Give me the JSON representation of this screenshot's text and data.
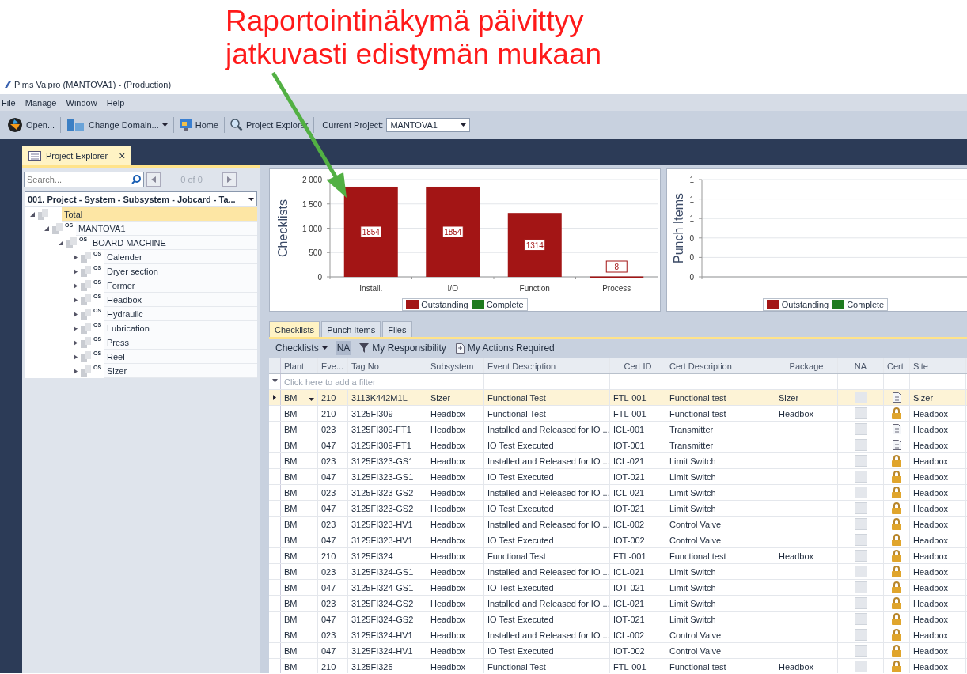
{
  "annotation": {
    "lines": [
      "Raportointinäkymä päivittyy",
      "jatkuvasti edistymän mukaan"
    ]
  },
  "window": {
    "title": "Pims Valpro (MANTOVA1) - (Production)"
  },
  "menu": [
    "File",
    "Manage",
    "Window",
    "Help"
  ],
  "toolbar": {
    "items": [
      {
        "label": "Open...",
        "kind": "open",
        "dropdown": false
      },
      {
        "label": "Change Domain...",
        "kind": "domain",
        "dropdown": true
      },
      {
        "label": "Home",
        "kind": "home",
        "dropdown": false
      },
      {
        "label": "Project Explorer",
        "kind": "explorer",
        "dropdown": false
      }
    ],
    "project_label": "Current Project:",
    "project_value": "MANTOVA1"
  },
  "doc_tabs": [
    {
      "label": "Project Explorer",
      "close": "×",
      "selected": true
    }
  ],
  "explorer": {
    "search": {
      "placeholder": "Search..."
    },
    "pager": "0 of 0",
    "view": "001. Project - System - Subsystem - Jobcard - Ta...",
    "tree": [
      {
        "label": "Total",
        "selected": true,
        "expanded": true,
        "children": [
          {
            "label": "MANTOVA1",
            "type_label": "OS",
            "selected": false,
            "expanded": true,
            "children": [
              {
                "label": "BOARD MACHINE",
                "type_label": "OS",
                "selected": false,
                "expanded": true,
                "children": [
                  {
                    "label": "Calender",
                    "type_label": "OS",
                    "selected": false,
                    "expanded": false
                  },
                  {
                    "label": "Dryer section",
                    "type_label": "OS",
                    "selected": false,
                    "expanded": false
                  },
                  {
                    "label": "Former",
                    "type_label": "OS",
                    "selected": false,
                    "expanded": false
                  },
                  {
                    "label": "Headbox",
                    "type_label": "OS",
                    "selected": false,
                    "expanded": false
                  },
                  {
                    "label": "Hydraulic",
                    "type_label": "OS",
                    "selected": false,
                    "expanded": false
                  },
                  {
                    "label": "Lubrication",
                    "type_label": "OS",
                    "selected": false,
                    "expanded": false
                  },
                  {
                    "label": "Press",
                    "type_label": "OS",
                    "selected": false,
                    "expanded": false
                  },
                  {
                    "label": "Reel",
                    "type_label": "OS",
                    "selected": false,
                    "expanded": false
                  },
                  {
                    "label": "Sizer",
                    "type_label": "OS",
                    "selected": false,
                    "expanded": false
                  }
                ]
              }
            ]
          }
        ]
      }
    ]
  },
  "charts": [
    {
      "chart_data": {
        "type": "bar",
        "ylabel": "Checklists",
        "categories": [
          "Install.",
          "I/O",
          "Function",
          "Process"
        ],
        "series": [
          {
            "name": "Outstanding",
            "color": "#a31515",
            "values": [
              1854,
              1854,
              1314,
              8
            ]
          },
          {
            "name": "Complete",
            "color": "#1e7b1e",
            "values": [
              null,
              null,
              null,
              null
            ]
          }
        ],
        "grid": true,
        "ylim": [
          0,
          2000
        ],
        "yticks": [
          0,
          {
            "value": 500,
            "label": "500"
          },
          {
            "value": 1000,
            "label": "1 000"
          },
          {
            "value": 1500,
            "label": "1 500"
          },
          {
            "value": 2000,
            "label": "2 000"
          }
        ],
        "data_labels": true
      }
    },
    {
      "chart_data": {
        "type": "bar",
        "ylabel": "Punch Items",
        "series": [
          {
            "name": "Outstanding",
            "color": "#a31515"
          },
          {
            "name": "Complete",
            "color": "#1e7b1e"
          }
        ],
        "grid": true,
        "ylim": [
          0,
          1
        ],
        "yticks": [
          {
            "value": 0,
            "label": "0"
          },
          {
            "value": 0.2,
            "label": "0"
          },
          {
            "value": 0.4,
            "label": "0"
          },
          {
            "value": 0.6,
            "label": "1"
          },
          {
            "value": 0.8,
            "label": "1"
          },
          {
            "value": 1,
            "label": "1"
          }
        ]
      }
    }
  ],
  "grid_tabs": [
    {
      "label": "Checklists",
      "selected": true
    },
    {
      "label": "Punch Items",
      "selected": false
    },
    {
      "label": "Files",
      "selected": false
    }
  ],
  "grid_toolbar": {
    "menu": "Checklists",
    "na": {
      "label": "NA",
      "pressed": true
    },
    "responsibility": "My Responsibility",
    "actions": "My Actions Required"
  },
  "table": {
    "columns": [
      "Plant",
      "Eve...",
      "Tag No",
      "Subsystem",
      "Event Description",
      "Cert ID",
      "Cert Description",
      "Package",
      "NA",
      "Cert",
      "Site"
    ],
    "filter_placeholder": "Click here to add a filter",
    "rows": [
      {
        "selected": true,
        "plant": "BM",
        "event": "210",
        "tag": "3113K442M1L",
        "subsystem": "Sizer",
        "description": "Functional Test",
        "cert_id": "FTL-001",
        "cert_description": "Functional test",
        "package": "Sizer",
        "na": false,
        "cert_locked": false,
        "site": "Sizer"
      },
      {
        "selected": false,
        "plant": "BM",
        "event": "210",
        "tag": "3125FI309",
        "subsystem": "Headbox",
        "description": "Functional Test",
        "cert_id": "FTL-001",
        "cert_description": "Functional test",
        "package": "Headbox",
        "na": false,
        "cert_locked": true,
        "site": "Headbox"
      },
      {
        "selected": false,
        "plant": "BM",
        "event": "023",
        "tag": "3125FI309-FT1",
        "subsystem": "Headbox",
        "description": "Installed and Released for IO ...",
        "cert_id": "ICL-001",
        "cert_description": "Transmitter",
        "na": false,
        "cert_locked": false,
        "site": "Headbox"
      },
      {
        "selected": false,
        "plant": "BM",
        "event": "047",
        "tag": "3125FI309-FT1",
        "subsystem": "Headbox",
        "description": "IO Test Executed",
        "cert_id": "IOT-001",
        "cert_description": "Transmitter",
        "na": false,
        "cert_locked": false,
        "site": "Headbox"
      },
      {
        "selected": false,
        "plant": "BM",
        "event": "023",
        "tag": "3125FI323-GS1",
        "subsystem": "Headbox",
        "description": "Installed and Released for IO ...",
        "cert_id": "ICL-021",
        "cert_description": "Limit Switch",
        "na": false,
        "cert_locked": true,
        "site": "Headbox"
      },
      {
        "selected": false,
        "plant": "BM",
        "event": "047",
        "tag": "3125FI323-GS1",
        "subsystem": "Headbox",
        "description": "IO Test Executed",
        "cert_id": "IOT-021",
        "cert_description": "Limit Switch",
        "na": false,
        "cert_locked": true,
        "site": "Headbox"
      },
      {
        "selected": false,
        "plant": "BM",
        "event": "023",
        "tag": "3125FI323-GS2",
        "subsystem": "Headbox",
        "description": "Installed and Released for IO ...",
        "cert_id": "ICL-021",
        "cert_description": "Limit Switch",
        "na": false,
        "cert_locked": true,
        "site": "Headbox"
      },
      {
        "selected": false,
        "plant": "BM",
        "event": "047",
        "tag": "3125FI323-GS2",
        "subsystem": "Headbox",
        "description": "IO Test Executed",
        "cert_id": "IOT-021",
        "cert_description": "Limit Switch",
        "na": false,
        "cert_locked": true,
        "site": "Headbox"
      },
      {
        "selected": false,
        "plant": "BM",
        "event": "023",
        "tag": "3125FI323-HV1",
        "subsystem": "Headbox",
        "description": "Installed and Released for IO ...",
        "cert_id": "ICL-002",
        "cert_description": "Control Valve",
        "na": false,
        "cert_locked": true,
        "site": "Headbox"
      },
      {
        "selected": false,
        "plant": "BM",
        "event": "047",
        "tag": "3125FI323-HV1",
        "subsystem": "Headbox",
        "description": "IO Test Executed",
        "cert_id": "IOT-002",
        "cert_description": "Control Valve",
        "na": false,
        "cert_locked": true,
        "site": "Headbox"
      },
      {
        "selected": false,
        "plant": "BM",
        "event": "210",
        "tag": "3125FI324",
        "subsystem": "Headbox",
        "description": "Functional Test",
        "cert_id": "FTL-001",
        "cert_description": "Functional test",
        "package": "Headbox",
        "na": false,
        "cert_locked": true,
        "site": "Headbox"
      },
      {
        "selected": false,
        "plant": "BM",
        "event": "023",
        "tag": "3125FI324-GS1",
        "subsystem": "Headbox",
        "description": "Installed and Released for IO ...",
        "cert_id": "ICL-021",
        "cert_description": "Limit Switch",
        "na": false,
        "cert_locked": true,
        "site": "Headbox"
      },
      {
        "selected": false,
        "plant": "BM",
        "event": "047",
        "tag": "3125FI324-GS1",
        "subsystem": "Headbox",
        "description": "IO Test Executed",
        "cert_id": "IOT-021",
        "cert_description": "Limit Switch",
        "na": false,
        "cert_locked": true,
        "site": "Headbox"
      },
      {
        "selected": false,
        "plant": "BM",
        "event": "023",
        "tag": "3125FI324-GS2",
        "subsystem": "Headbox",
        "description": "Installed and Released for IO ...",
        "cert_id": "ICL-021",
        "cert_description": "Limit Switch",
        "na": false,
        "cert_locked": true,
        "site": "Headbox"
      },
      {
        "selected": false,
        "plant": "BM",
        "event": "047",
        "tag": "3125FI324-GS2",
        "subsystem": "Headbox",
        "description": "IO Test Executed",
        "cert_id": "IOT-021",
        "cert_description": "Limit Switch",
        "na": false,
        "cert_locked": true,
        "site": "Headbox"
      },
      {
        "selected": false,
        "plant": "BM",
        "event": "023",
        "tag": "3125FI324-HV1",
        "subsystem": "Headbox",
        "description": "Installed and Released for IO ...",
        "cert_id": "ICL-002",
        "cert_description": "Control Valve",
        "na": false,
        "cert_locked": true,
        "site": "Headbox"
      },
      {
        "selected": false,
        "plant": "BM",
        "event": "047",
        "tag": "3125FI324-HV1",
        "subsystem": "Headbox",
        "description": "IO Test Executed",
        "cert_id": "IOT-002",
        "cert_description": "Control Valve",
        "na": false,
        "cert_locked": true,
        "site": "Headbox"
      },
      {
        "selected": false,
        "plant": "BM",
        "event": "210",
        "tag": "3125FI325",
        "subsystem": "Headbox",
        "description": "Functional Test",
        "cert_id": "FTL-001",
        "cert_description": "Functional test",
        "package": "Headbox",
        "na": false,
        "cert_locked": true,
        "site": "Headbox"
      }
    ]
  }
}
